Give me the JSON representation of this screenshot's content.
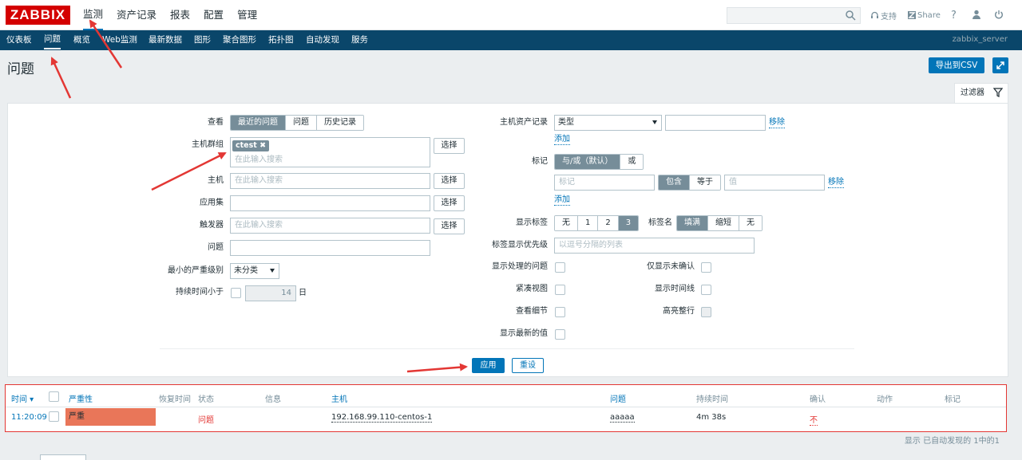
{
  "logo": "ZABBIX",
  "main_menu": [
    "监测",
    "资产记录",
    "报表",
    "配置",
    "管理"
  ],
  "top_links": {
    "support": "支持",
    "share": "Share",
    "help": "?"
  },
  "sub_menu": [
    "仪表板",
    "问题",
    "概览",
    "Web监测",
    "最新数据",
    "图形",
    "聚合图形",
    "拓扑图",
    "自动发现",
    "服务"
  ],
  "server_name": "zabbix_server",
  "page_title": "问题",
  "export_csv": "导出到CSV",
  "filter_tab": "过滤器",
  "filter": {
    "view_label": "查看",
    "view_options": [
      "最近的问题",
      "问题",
      "历史记录"
    ],
    "host_group_label": "主机群组",
    "host_group_tag": "ctest",
    "host_group_placeholder": "在此输入搜索",
    "host_label": "主机",
    "host_placeholder": "在此输入搜索",
    "app_label": "应用集",
    "trigger_label": "触发器",
    "trigger_placeholder": "在此输入搜索",
    "problem_label": "问题",
    "min_severity_label": "最小的严重级别",
    "min_severity_value": "未分类",
    "duration_label": "持续时间小于",
    "duration_value": "14",
    "duration_unit": "日",
    "select_btn": "选择",
    "inventory_label": "主机资产记录",
    "inventory_type": "类型",
    "remove": "移除",
    "add": "添加",
    "tags_label": "标记",
    "tags_options": [
      "与/或（默认）",
      "或"
    ],
    "tag_placeholder": "标记",
    "tag_ops": [
      "包含",
      "等于"
    ],
    "value_placeholder": "值",
    "show_tags_label": "显示标签",
    "show_tags_options": [
      "无",
      "1",
      "2",
      "3"
    ],
    "tag_name_label": "标签名",
    "tag_name_options": [
      "填满",
      "缩短",
      "无"
    ],
    "tag_priority_label": "标签显示优先级",
    "tag_priority_placeholder": "以逗号分隔的列表",
    "show_suppressed": "显示处理的问题",
    "show_unack": "仅显示未确认",
    "compact": "紧凑视图",
    "timeline": "显示时间线",
    "details": "查看细节",
    "highlight": "高亮整行",
    "latest_values": "显示最新的值",
    "apply": "应用",
    "reset": "重设"
  },
  "table": {
    "headers": [
      "时间 ▾",
      "严重性",
      "恢复时间",
      "状态",
      "信息",
      "主机",
      "问题",
      "持续时间",
      "确认",
      "动作",
      "标记"
    ],
    "row": {
      "time": "11:20:09",
      "severity": "严重",
      "status": "问题",
      "host": "192.168.99.110-centos-1",
      "problem": "aaaaa",
      "duration": "4m 38s",
      "ack": "不"
    },
    "footer": "显示 已自动发现的 1中的1"
  },
  "colors": {
    "accent": "#0275b8",
    "nav": "#0a466a",
    "severity_high": "#e97659",
    "arrow": "#e33734"
  }
}
